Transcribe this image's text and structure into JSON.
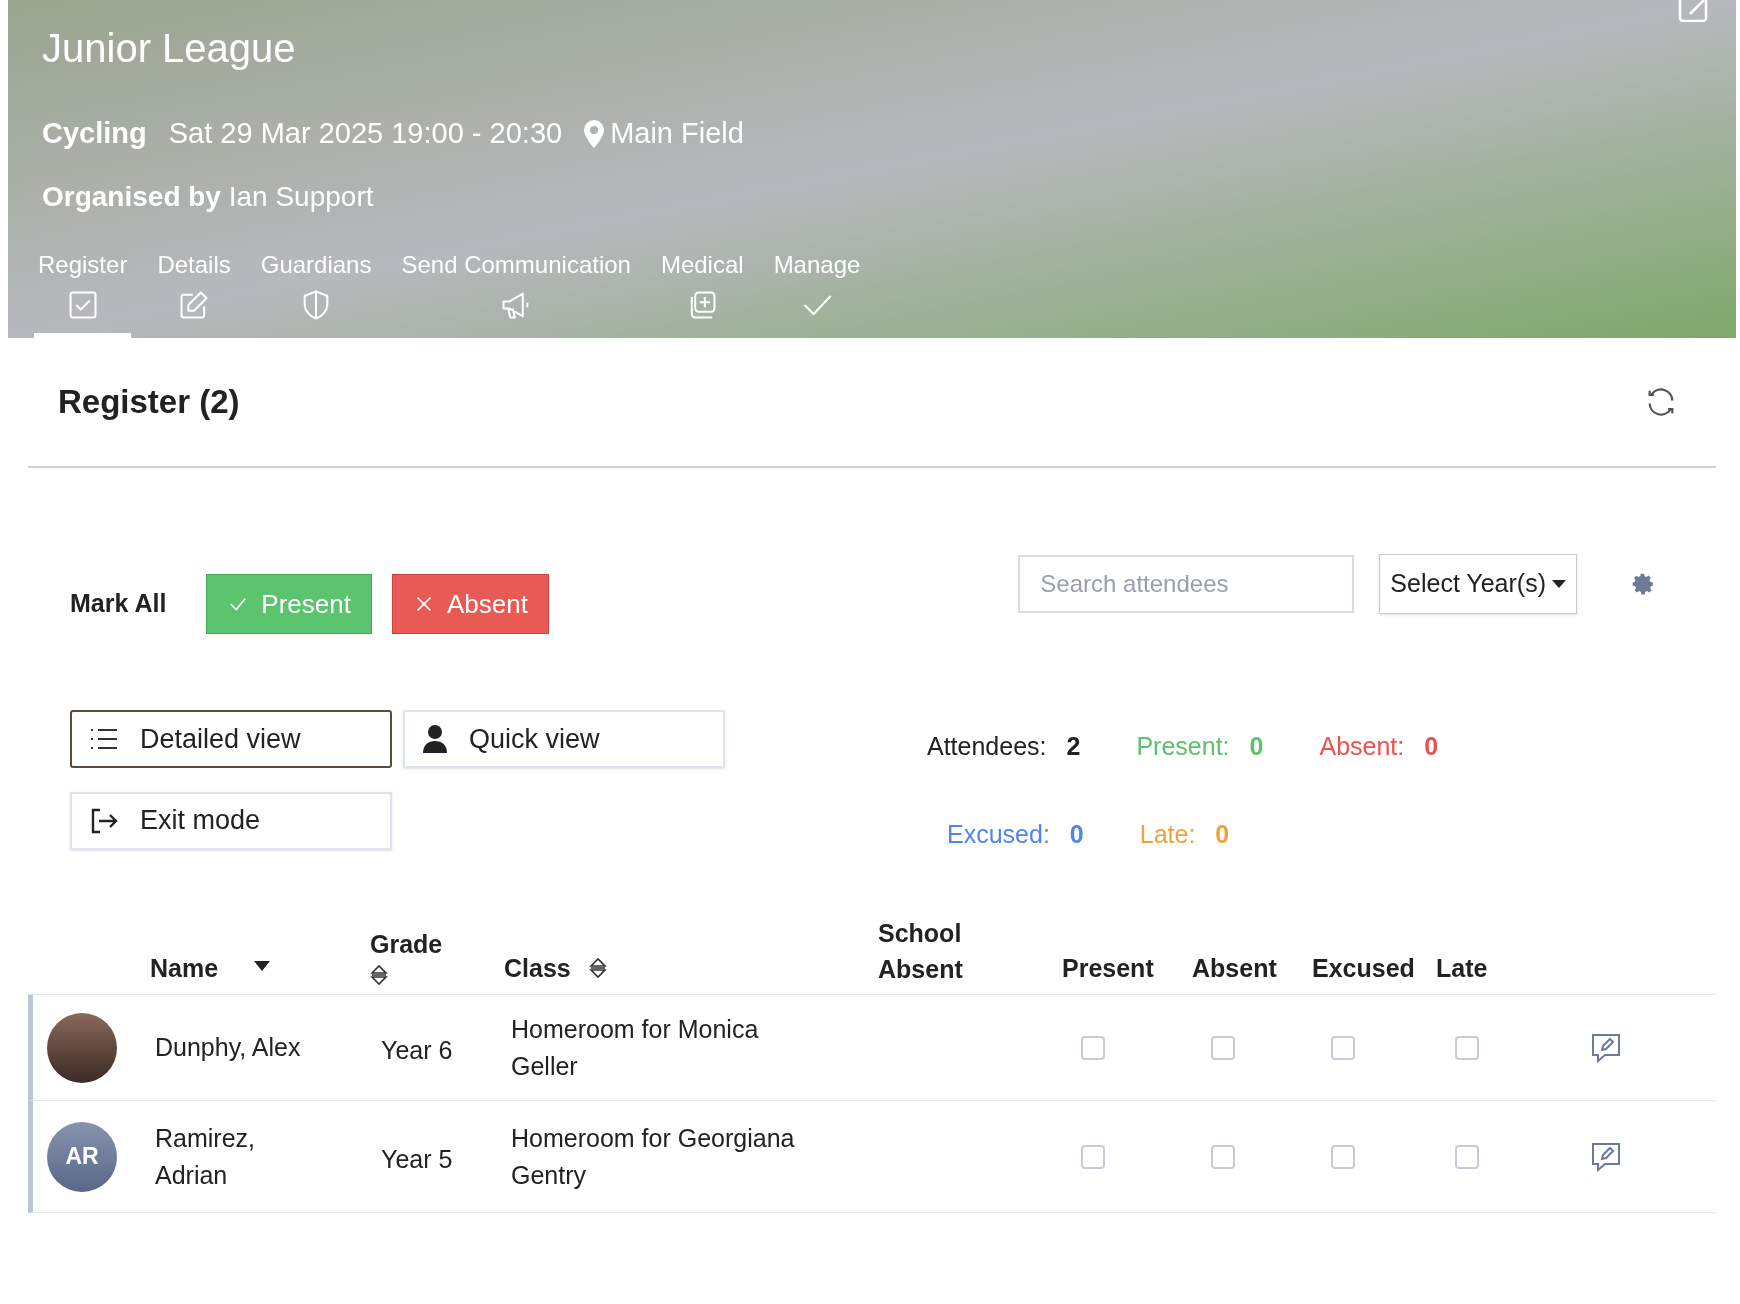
{
  "header": {
    "title": "Junior League",
    "activity": "Cycling",
    "datetime": "Sat 29 Mar 2025 19:00 - 20:30",
    "location": "Main Field",
    "organiser_label": "Organised by",
    "organiser": "Ian Support"
  },
  "tabs": [
    {
      "label": "Register",
      "kind": "checkbox",
      "selected": true
    },
    {
      "label": "Details",
      "kind": "edit",
      "selected": false
    },
    {
      "label": "Guardians",
      "kind": "shield",
      "selected": false
    },
    {
      "label": "Send Communication",
      "kind": "megaphone",
      "selected": false
    },
    {
      "label": "Medical",
      "kind": "medical",
      "selected": false
    },
    {
      "label": "Manage",
      "kind": "check",
      "selected": false
    }
  ],
  "register": {
    "title": "Register (2)"
  },
  "mark_all": {
    "label": "Mark All",
    "buttons": [
      {
        "kind": "present",
        "label": "Present"
      },
      {
        "kind": "absent",
        "label": "Absent"
      }
    ]
  },
  "search": {
    "placeholder": "Search attendees"
  },
  "year_select": {
    "value": "Select Year(s)"
  },
  "view_buttons": [
    {
      "kind": "detailed",
      "label": "Detailed view",
      "selected": true
    },
    {
      "kind": "quick",
      "label": "Quick view",
      "selected": false
    },
    {
      "kind": "exit",
      "label": "Exit mode",
      "selected": false
    }
  ],
  "stats": [
    {
      "label": "Attendees:",
      "value": "2",
      "color": "#222222"
    },
    {
      "label": "Present:",
      "value": "0",
      "color": "#5cc26a"
    },
    {
      "label": "Absent:",
      "value": "0",
      "color": "#e8534f"
    },
    {
      "label": "Excused:",
      "value": "0",
      "color": "#4f86e8"
    },
    {
      "label": "Late:",
      "value": "0",
      "color": "#eda23a"
    }
  ],
  "table": {
    "columns": [
      {
        "label": "Name",
        "sortable": true,
        "sorted_descending": true
      },
      {
        "label": "Grade",
        "sortable": true,
        "sorted_descending": false
      },
      {
        "label": "Class",
        "sortable": true,
        "sorted_descending": false
      },
      {
        "label": "School Absent"
      },
      {
        "label": "Present"
      },
      {
        "label": "Absent"
      },
      {
        "label": "Excused"
      },
      {
        "label": "Late"
      }
    ],
    "rows": [
      {
        "avatar": {
          "kind": "photo"
        },
        "name": "Dunphy, Alex",
        "grade": "Year 6",
        "class": "Homeroom for Monica Geller",
        "present": false,
        "absent": false,
        "excused": false,
        "late": false
      },
      {
        "avatar": {
          "kind": "initials",
          "initials": "AR"
        },
        "name": "Ramirez, Adrian",
        "grade": "Year 5",
        "class": "Homeroom for Georgiana Gentry",
        "present": false,
        "absent": false,
        "excused": false,
        "late": false
      }
    ]
  }
}
